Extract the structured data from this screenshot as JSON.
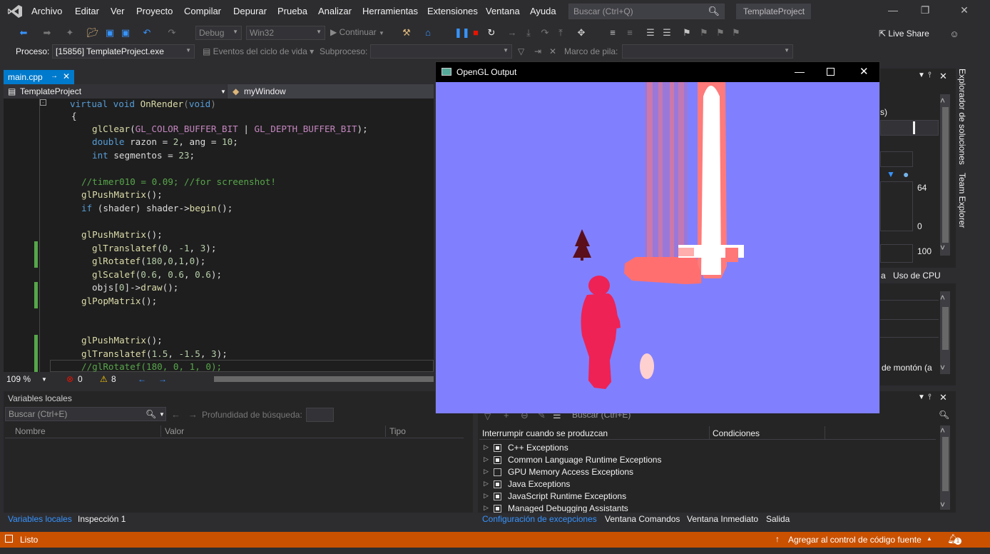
{
  "menu": [
    "Archivo",
    "Editar",
    "Ver",
    "Proyecto",
    "Compilar",
    "Depurar",
    "Prueba",
    "Analizar",
    "Herramientas",
    "Extensiones",
    "Ventana",
    "Ayuda"
  ],
  "search_placeholder": "Buscar (Ctrl+Q)",
  "project_name": "TemplateProject",
  "toolbar": {
    "config": "Debug",
    "platform": "Win32",
    "continue_label": "Continuar",
    "liveshare": "Live Share"
  },
  "procbar": {
    "proceso_label": "Proceso:",
    "process_value": "[15856] TemplateProject.exe",
    "lifecycle": "Eventos del ciclo de vida",
    "subproceso": "Subproceso:",
    "stack_label": "Marco de pila:"
  },
  "editor": {
    "tab": "main.cpp",
    "nav_left": "TemplateProject",
    "nav_right": "myWindow",
    "zoom": "109 %",
    "errors": "0",
    "warnings": "8"
  },
  "side_tabs": [
    "Explorador de soluciones",
    "Team Explorer"
  ],
  "right_panel": {
    "value_64": "64",
    "value_0": "0",
    "value_100": "100",
    "cpu_tab": "Uso de CPU",
    "tab_fragment": "a",
    "paren": "s)",
    "heap_fragment": "de montón (a"
  },
  "locals": {
    "title": "Variables locales",
    "search": "Buscar (Ctrl+E)",
    "depth": "Profundidad de búsqueda:",
    "cols": [
      "Nombre",
      "Valor",
      "Tipo"
    ],
    "tabs": [
      "Variables locales",
      "Inspección 1"
    ]
  },
  "exceptions": {
    "search": "Buscar (Ctrl+E)",
    "col1": "Interrumpir cuando se produzcan",
    "col2": "Condiciones",
    "items": [
      {
        "label": "C++ Exceptions",
        "checked": true
      },
      {
        "label": "Common Language Runtime Exceptions",
        "checked": true
      },
      {
        "label": "GPU Memory Access Exceptions",
        "checked": false
      },
      {
        "label": "Java Exceptions",
        "checked": true
      },
      {
        "label": "JavaScript Runtime Exceptions",
        "checked": true
      },
      {
        "label": "Managed Debugging Assistants",
        "checked": true
      }
    ],
    "tabs": [
      "Configuración de excepciones",
      "Ventana Comandos",
      "Ventana Inmediato",
      "Salida"
    ]
  },
  "status": {
    "ready": "Listo",
    "source_control": "Agregar al control de código fuente",
    "notifications": "1"
  },
  "gl_window": {
    "title": "OpenGL Output"
  },
  "colors": {
    "accent": "#007acc",
    "statusbar": "#ca5100",
    "gl_background": "#8080ff"
  }
}
